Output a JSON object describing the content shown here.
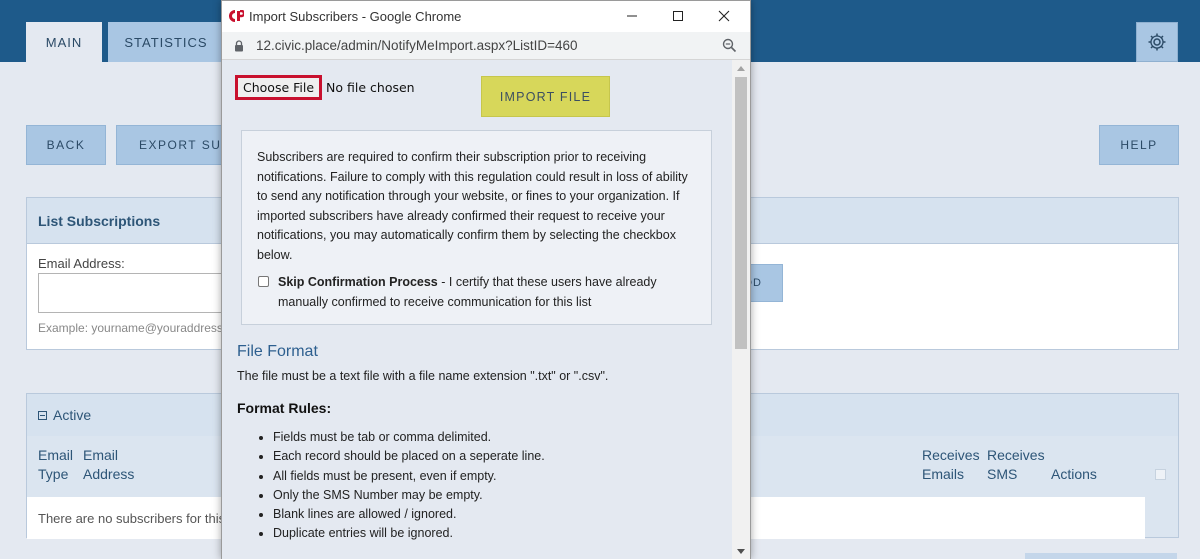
{
  "app": {
    "tabs": [
      {
        "label": "MAIN"
      },
      {
        "label": "STATISTICS"
      }
    ],
    "toolbar": {
      "back_label": "BACK",
      "export_label": "EXPORT SUBSCRIBERS",
      "help_label": "HELP"
    },
    "list_panel": {
      "title": "List Subscriptions",
      "email_label": "Email Address:",
      "email_value": "",
      "email_hint": "Example: yourname@youraddress.com",
      "add_label": "ADD"
    },
    "active_panel": {
      "title": "Active",
      "columns": {
        "email_type": [
          "Email",
          "Type"
        ],
        "email_address": [
          "Email",
          "Address"
        ],
        "receives_emails": [
          "Receives",
          "Emails"
        ],
        "receives_sms": [
          "Receives",
          "SMS"
        ],
        "actions": "Actions"
      },
      "empty_text": "There are no subscribers for this list."
    }
  },
  "popup": {
    "window_title": "Import Subscribers - Google Chrome",
    "url": "12.civic.place/admin/NotifyMeImport.aspx?ListID=460",
    "choose_file_label": "Choose File",
    "no_file_text": "No file chosen",
    "import_label": "IMPORT FILE",
    "notice_text": "Subscribers are required to confirm their subscription prior to receiving notifications. Failure to comply with this regulation could result in loss of ability to send any notification through your website, or fines to your organization. If imported subscribers have already confirmed their request to receive your notifications, you may automatically confirm them by selecting the checkbox below.",
    "skip_title": "Skip Confirmation Process",
    "skip_desc": " - I certify that these users have already manually confirmed to receive communication for this list",
    "skip_checked": false,
    "file_format_heading": "File Format",
    "file_format_desc": "The file must be a text file with a file name extension \".txt\" or \".csv\".",
    "format_rules_heading": "Format Rules:",
    "rules": [
      "Fields must be tab or comma delimited.",
      "Each record should be placed on a seperate line.",
      "All fields must be present, even if empty.",
      "Only the SMS Number may be empty.",
      "Blank lines are allowed / ignored.",
      "Duplicate entries will be ignored."
    ]
  },
  "colors": {
    "header_blue": "#1e5a8a",
    "button_blue": "#a9c6e3",
    "import_yellow": "#d7d75a",
    "highlight_red": "#c8102e"
  },
  "icons": {
    "settings": "gear-icon",
    "lock": "lock-icon",
    "zoom": "zoom-icon",
    "collapse": "collapse-icon"
  }
}
